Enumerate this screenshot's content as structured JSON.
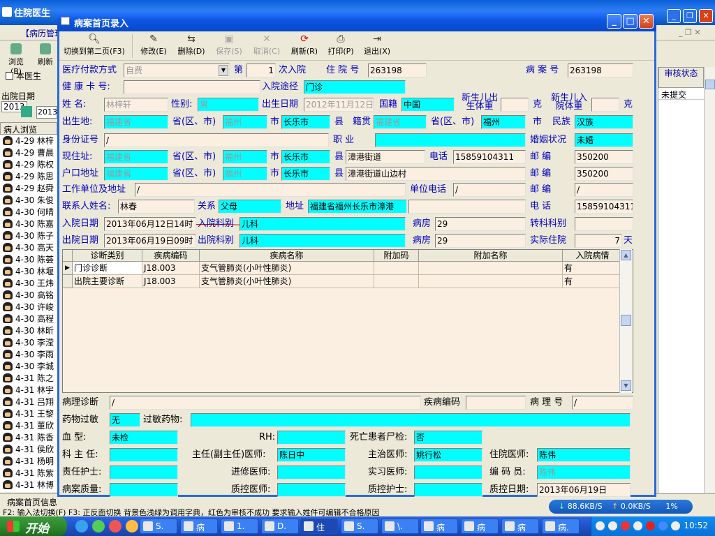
{
  "bg": {
    "title": "住院医生",
    "menu_item": "【病历管理",
    "toolbar": [
      "浏览(B)",
      "刷新"
    ],
    "only_doctor": "本医生",
    "out_date_label": "出院日期",
    "date1": "2013",
    "date2": "2013",
    "list_header": "病人浏览",
    "patients": [
      "4-29 林梓",
      "4-29 曹晨",
      "4-29 陈权",
      "4-29 陈思",
      "4-29 赵舜",
      "4-30 朱俊",
      "4-30 何晴",
      "4-30 陈嘉",
      "4-30 陈子",
      "4-30 高天",
      "4-30 陈荟",
      "4-30 林堰",
      "4-30 王炜",
      "4-30 高铭",
      "4-30 许峻",
      "4-30 高程",
      "4-30 林昕",
      "4-30 李滢",
      "4-30 李雨",
      "4-30 李城",
      "4-31 陈之",
      "4-31 林宇",
      "4-31 吕翔",
      "4-31 王黎",
      "4-31 董欣",
      "4-31 陈香",
      "4-31 侯欣",
      "4-31 杨明",
      "4-31 陈紫",
      "4-31 林博"
    ],
    "right_header": "审核状态",
    "right_value": "未提交",
    "status_left": "病案首页信息",
    "status_line": "F2: 输入法切换(F) F3: 正反面切换   背景色浅绿为调用字典，红色为审核不成功   要求输入姓件可编辑不合格原因"
  },
  "dialog": {
    "title": "病案首页录入",
    "toolbar": {
      "switch": "切换到第二页(F3)",
      "edit": "修改(E)",
      "delete": "删除(D)",
      "save": "保存(S)",
      "cancel": "取消(C)",
      "refresh": "刷新(R)",
      "print": "打印(P)",
      "exit": "退出(X)"
    },
    "form": {
      "pay_label": "医疗付款方式",
      "pay": "自费",
      "no_label": "第",
      "times": "1",
      "times_suffix": "次入院",
      "inpatient_label": "住 院 号",
      "inpatient_no": "263198",
      "case_label": "病 案 号",
      "case_no": "263198",
      "card_label": "健 康 卡 号:",
      "card": "",
      "route_label": "入院途径",
      "route": "门诊",
      "name_label": "姓   名:",
      "name": "林梓轩",
      "sex_label": "性别:",
      "sex": "男",
      "birth_label": "出生日期",
      "birth": "2012年11月12日",
      "nation_label": "国籍",
      "nation": "中国",
      "nb_weight_label": "新生儿出生体重",
      "nb_weight": "",
      "gram": "克",
      "nb_in_weight_label": "新生儿入院体重",
      "nb_in_weight": "",
      "gram2": "克",
      "birthplace_label": "出生地:",
      "birth_prov": "福建省",
      "prov_label": "省(区、市)",
      "birth_city": "福州",
      "city_label": "市",
      "birth_county": "长乐市",
      "county_label": "县",
      "origin_label": "籍贯",
      "origin_prov": "福建省",
      "prov_label2": "省(区、市)",
      "origin_city": "福州",
      "city_label2": "市",
      "ethnic_label": "民族",
      "ethnic": "汉族",
      "id_label": "身份证号",
      "id": "/",
      "job_label": "职    业",
      "job": "",
      "marital_label": "婚姻状况",
      "marital": "未婚",
      "addr_label": "现住址:",
      "addr_prov": "福建省",
      "prov_label3": "省(区、市)",
      "addr_city": "福州",
      "city_label3": "市",
      "addr_county": "长乐市",
      "county_label3": "县",
      "addr_street": "漳港街道",
      "phone_label": "电话",
      "phone": "15859104311",
      "post_label": "邮    编",
      "post": "350200",
      "hukou_label": "户口地址",
      "hukou_prov": "福建省",
      "prov_label4": "省(区、市)",
      "hukou_city": "福州",
      "city_label4": "市",
      "hukou_county": "长乐市",
      "county_label4": "县",
      "hukou_street": "漳港街道山边村",
      "post_label2": "邮    编",
      "post2": "350200",
      "work_label": "工作单位及地址",
      "work": "/",
      "work_phone_label": "单位电话",
      "work_phone": "/",
      "post_label3": "邮    编",
      "post3": "/",
      "contact_label": "联系人姓名:",
      "contact": "林春",
      "relation_label": "关系",
      "relation": "父母",
      "contact_addr_label": "地址",
      "contact_addr": "福建省福州长乐市漳港",
      "contact_addr2": "",
      "tel_label": "电    话",
      "tel": "15859104311",
      "in_date_label": "入院日期",
      "in_date": "2013年06月12日14时",
      "in_dept_label": "入院科别",
      "in_dept": "儿科",
      "ward_label": "病房",
      "ward": "29",
      "transfer_label": "转科科别",
      "transfer": "",
      "out_date_label": "出院日期",
      "out_date": "2013年06月19日09时",
      "out_dept_label": "出院科别",
      "out_dept": "儿科",
      "ward_label2": "病房",
      "ward2": "29",
      "days_label": "实际住院",
      "days": "7",
      "days_unit": "天",
      "patho_diag_label": "病理诊断",
      "patho_diag": "/",
      "disease_code_label": "疾病编码",
      "disease_code": "",
      "patho_no_label": "病 理 号",
      "patho_no": "/",
      "allergy_label": "药物过敏",
      "allergy": "无",
      "allergy_drug_label": "过敏药物:",
      "allergy_drug": "",
      "blood_label": "血    型:",
      "blood": "未检",
      "rh_label": "RH:",
      "rh": "",
      "autopsy_label": "死亡患者尸检:",
      "autopsy": "否",
      "director_label": "科 主 任:",
      "director": "",
      "chief_label": "主任(副主任)医师:",
      "chief": "陈日中",
      "attending_label": "主治医师:",
      "attending": "姚行松",
      "resident_label": "住院医师:",
      "resident": "陈伟",
      "nurse_label": "责任护士:",
      "nurse": "",
      "fellow_label": "进修医师:",
      "fellow": "",
      "intern_label": "实习医师:",
      "intern": "",
      "coder_label": "编 码 员:",
      "coder": "陈伟",
      "quality_label": "病案质量:",
      "quality": "",
      "qc_doc_label": "质控医师:",
      "qc_doc": "",
      "qc_nurse_label": "质控护士:",
      "qc_nurse": "",
      "qc_date_label": "质控日期:",
      "qc_date": "2013年06月19日"
    },
    "grid": {
      "headers": [
        "诊断类别",
        "疾病编码",
        "疾病名称",
        "附加码",
        "附加名称",
        "入院病情"
      ],
      "rows": [
        [
          "门诊诊断",
          "J18.003",
          "支气管肺炎(小叶性肺炎)",
          "",
          "",
          "有"
        ],
        [
          "出院主要诊断",
          "J18.003",
          "支气管肺炎(小叶性肺炎)",
          "",
          "",
          "有"
        ]
      ]
    }
  },
  "net": {
    "down": "88.6KB/S",
    "up": "0.0KB/S",
    "pct": "1%"
  },
  "taskbar": {
    "start": "开始",
    "tasks": [
      "S.",
      "病",
      "1.",
      "D.",
      "住",
      "S.",
      "\\.",
      "病",
      "病",
      "病",
      "病."
    ],
    "clock": "10:52"
  }
}
